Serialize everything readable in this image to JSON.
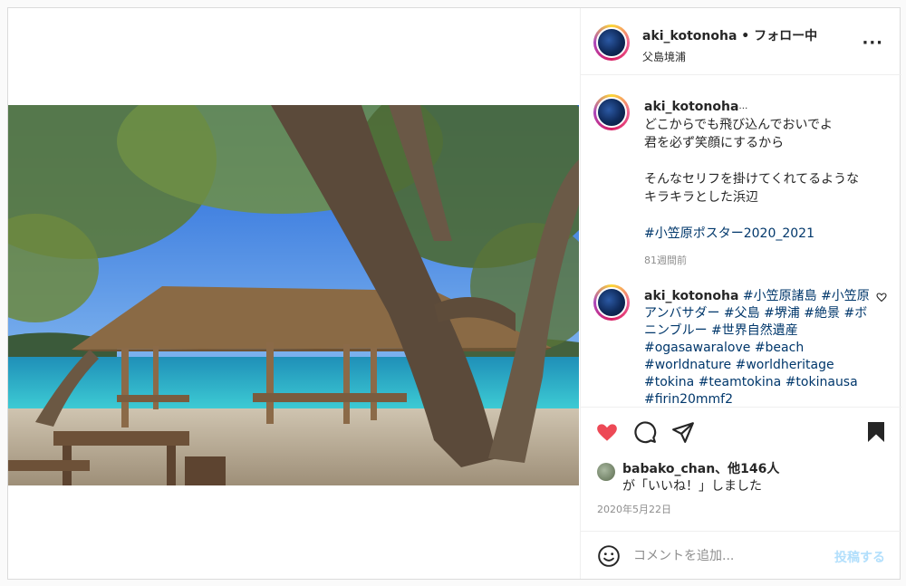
{
  "post": {
    "username": "aki_kotonoha",
    "separator": "•",
    "follow_label": "フォロー中",
    "location": "父島境浦",
    "more_label": "···"
  },
  "caption": {
    "username": "aki_kotonoha",
    "edited_mark": "…",
    "lines": [
      "どこからでも飛び込んでおいでよ",
      "君を必ず笑顔にするから",
      "",
      "そんなセリフを掛けてくれてるような",
      "キラキラとした浜辺",
      ""
    ],
    "hashtag": "#小笠原ポスター2020_2021",
    "time": "81週間前"
  },
  "comment": {
    "username": "aki_kotonoha",
    "tags": [
      "#小笠原諸島",
      "#小笠原アンバサダー",
      "#父島",
      "#堺浦",
      "#絶景",
      "#ボニンブルー",
      "#世界自然遺産",
      "#ogasawaralove",
      "#beach",
      "#worldnature",
      "#worldheritage",
      "#tokina",
      "#teamtokina",
      "#tokinausa",
      "#firin20mmf2"
    ]
  },
  "actions": {
    "like_icon": "heart-filled-icon",
    "comment_icon": "comment-icon",
    "share_icon": "send-icon",
    "save_icon": "bookmark-icon",
    "like_color": "#ed4956"
  },
  "likes": {
    "user": "babako_chan",
    "others": "、他146人",
    "suffix": "が「いいね！」しました"
  },
  "date": "2020年5月22日",
  "add_comment": {
    "placeholder": "コメントを追加...",
    "post_label": "投稿する"
  }
}
